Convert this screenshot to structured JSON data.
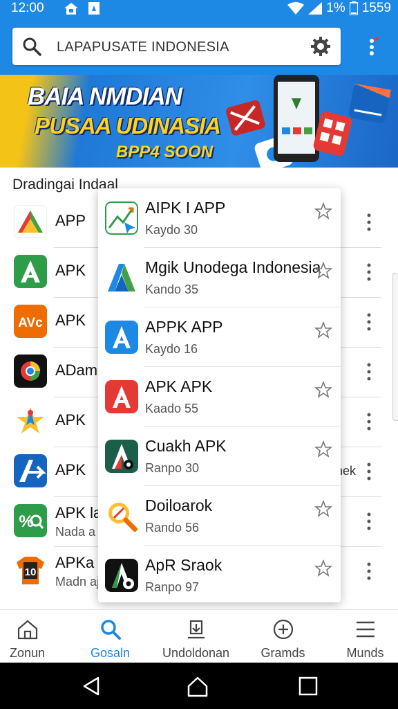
{
  "status_bar": {
    "time": "12:00",
    "battery_percent": "1%",
    "extra": "1559"
  },
  "search": {
    "value": "LAPAPUSATE INDONESIA"
  },
  "banner": {
    "line1": "BAIA NMDIAN",
    "line2": "PUSAA UDINASIA",
    "line3": "BPP4 SOON"
  },
  "section_title": "Dradingai Indaal",
  "app_list": [
    {
      "name": "APP",
      "sub": "",
      "extra": ""
    },
    {
      "name": "APK",
      "sub": "",
      "extra": ""
    },
    {
      "name": "APK",
      "sub": "",
      "extra": ""
    },
    {
      "name": "ADama",
      "sub": "",
      "extra": ""
    },
    {
      "name": "APK",
      "sub": "",
      "extra": ""
    },
    {
      "name": "APK",
      "sub": "",
      "extra": "nek"
    },
    {
      "name": "APK la",
      "sub": "Nada a",
      "extra": ""
    },
    {
      "name": "APKa l",
      "sub": "Madn aj",
      "extra": ""
    }
  ],
  "popup_items": [
    {
      "title": "AIPK I APP",
      "sub": "Kaydo 30"
    },
    {
      "title": "Mgik Unodega Indonesia",
      "sub": "Kando 35"
    },
    {
      "title": "APPK APP",
      "sub": "Kaydo 16"
    },
    {
      "title": "APK APK",
      "sub": "Kaado 55"
    },
    {
      "title": "Cuakh APK",
      "sub": "Ranpo 30"
    },
    {
      "title": "Doiloarok",
      "sub": "Rando 56"
    },
    {
      "title": "ApR Sraok",
      "sub": "Ranpo 97"
    }
  ],
  "bottom_nav": [
    {
      "label": "Zonun",
      "icon": "home-icon",
      "active": false
    },
    {
      "label": "Gosaln",
      "icon": "search-icon",
      "active": true
    },
    {
      "label": "Undoldonan",
      "icon": "download-icon",
      "active": false
    },
    {
      "label": "Gramds",
      "icon": "plus-circle-icon",
      "active": false
    },
    {
      "label": "Munds",
      "icon": "menu-icon",
      "active": false
    }
  ],
  "colors": {
    "primary": "#1e88e5",
    "banner_yellow": "#ffd21f"
  }
}
